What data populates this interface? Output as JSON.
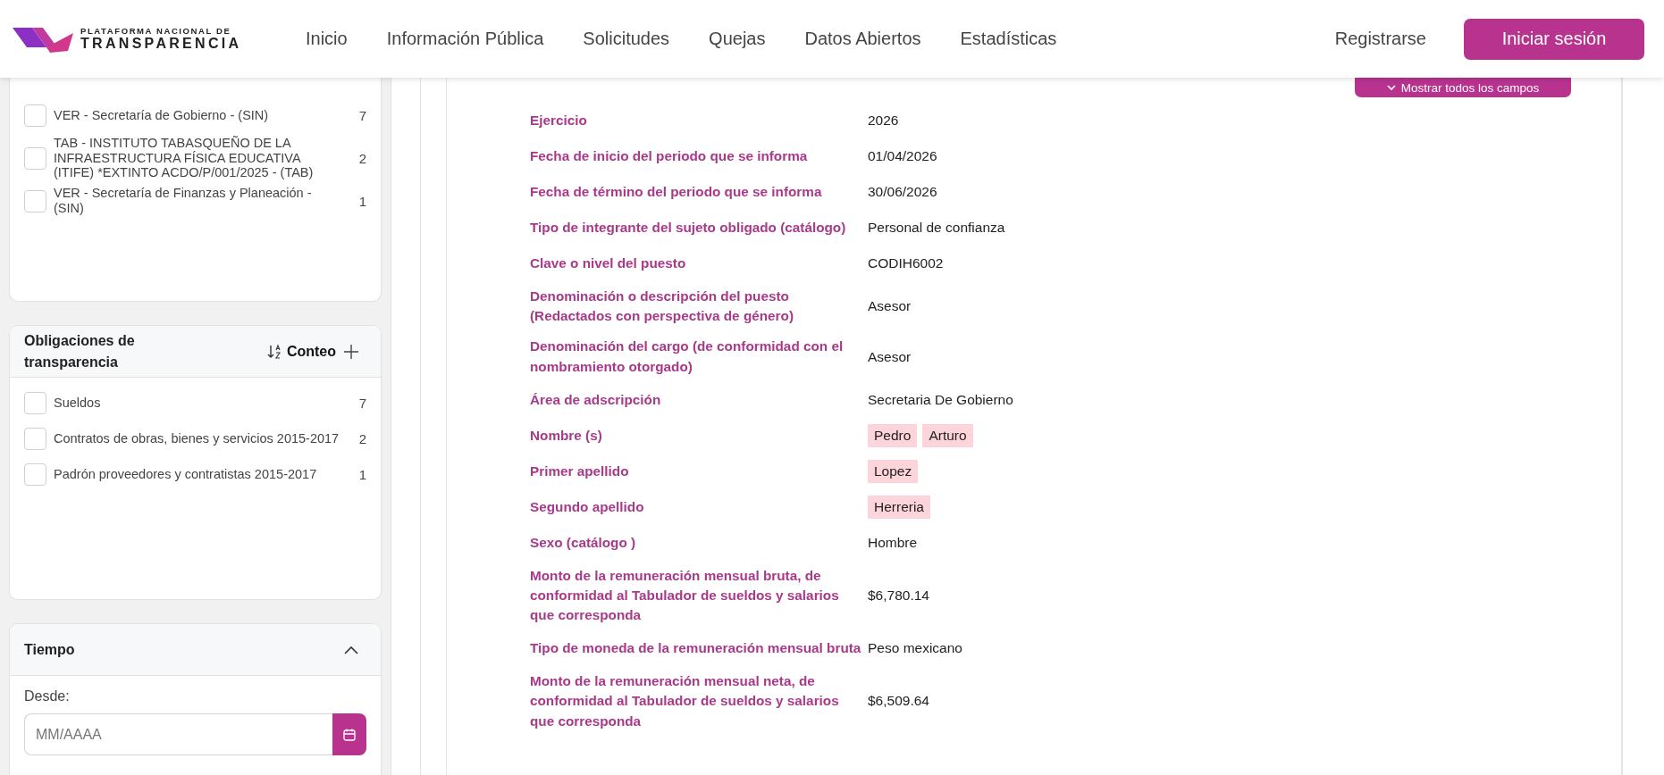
{
  "header": {
    "logo": {
      "line_1": "PLATAFORMA NACIONAL DE",
      "line_2": "TRANSPARENCIA"
    },
    "nav": [
      "Inicio",
      "Información Pública",
      "Solicitudes",
      "Quejas",
      "Datos Abiertos",
      "Estadísticas"
    ],
    "register": "Registrarse",
    "login": "Iniciar sesión"
  },
  "sidebar": {
    "institutions": [
      {
        "label": "VER - Secretaría de Gobierno - (SIN)",
        "count": "7",
        "checked": false
      },
      {
        "label": "TAB - INSTITUTO TABASQUEÑO DE LA INFRAESTRUCTURA FÍSICA EDUCATIVA (ITIFE) *EXTINTO ACDO/P/001/2025 - (TAB)",
        "count": "2",
        "checked": false
      },
      {
        "label": "VER - Secretaría de Finanzas y Planeación - (SIN)",
        "count": "1",
        "checked": false
      }
    ],
    "obligations": {
      "title": "Obligaciones de transparencia",
      "sort": "Conteo",
      "items": [
        {
          "label": "Sueldos",
          "count": "7",
          "checked": false
        },
        {
          "label": "Contratos de obras, bienes y servicios 2015-2017",
          "count": "2",
          "checked": false
        },
        {
          "label": "Padrón proveedores y contratistas 2015-2017",
          "count": "1",
          "checked": false
        }
      ]
    },
    "time": {
      "title": "Tiempo",
      "expanded": true,
      "from_label": "Desde:",
      "from_placeholder": "MM/AAAA"
    }
  },
  "record": {
    "show_all": "Mostrar todos los campos",
    "fields": [
      {
        "label": "Ejercicio",
        "kind": "text",
        "value": "2026"
      },
      {
        "label": "Fecha de inicio del periodo que se informa",
        "kind": "text",
        "value": "01/04/2026"
      },
      {
        "label": "Fecha de término del periodo que se informa",
        "kind": "text",
        "value": "30/06/2026"
      },
      {
        "label": "Tipo de integrante del sujeto obligado (catálogo)",
        "kind": "text",
        "value": "Personal de confianza"
      },
      {
        "label": "Clave o nivel del puesto",
        "kind": "text",
        "value": "CODIH6002"
      },
      {
        "label": "Denominación o descripción del puesto (Redactados con perspectiva de género)",
        "kind": "text",
        "value": "Asesor"
      },
      {
        "label": "Denominación del cargo (de conformidad con el nombramiento otorgado)",
        "kind": "text",
        "value": "Asesor"
      },
      {
        "label": "Área de adscripción",
        "kind": "text",
        "value": "Secretaria De Gobierno"
      },
      {
        "label": "Nombre (s)",
        "kind": "highlighted",
        "parts": [
          "Pedro",
          "Arturo"
        ]
      },
      {
        "label": "Primer apellido",
        "kind": "highlighted",
        "parts": [
          "Lopez"
        ]
      },
      {
        "label": "Segundo apellido",
        "kind": "highlighted",
        "parts": [
          "Herreria"
        ]
      },
      {
        "label": "Sexo (catálogo )",
        "kind": "text",
        "value": "Hombre"
      },
      {
        "label": "Monto de la remuneración mensual bruta, de conformidad al Tabulador de sueldos y salarios que corresponda",
        "kind": "text",
        "value": "$6,780.14"
      },
      {
        "label": "Tipo de moneda de la remuneración mensual bruta",
        "kind": "text",
        "value": "Peso mexicano"
      },
      {
        "label": "Monto de la remuneración mensual neta, de conformidad al Tabulador de sueldos y salarios que corresponda",
        "kind": "text",
        "value": "$6,509.64"
      }
    ]
  }
}
